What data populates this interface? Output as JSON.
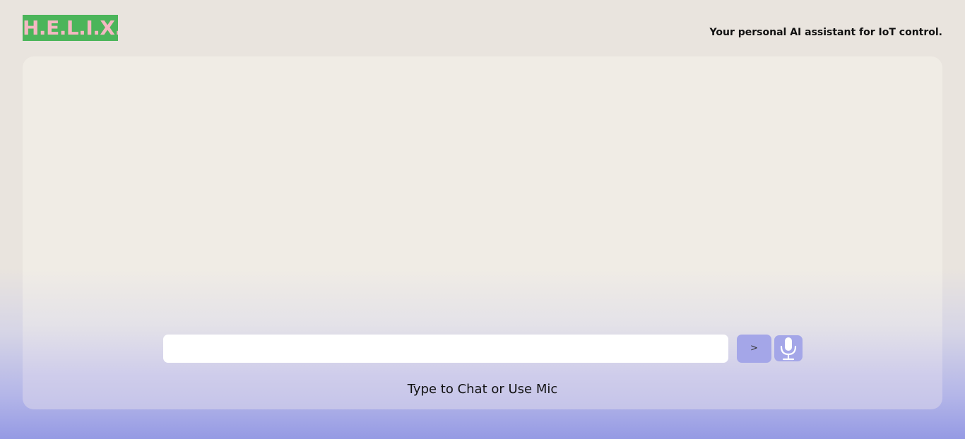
{
  "header": {
    "logo_text": "H.E.L.I.X.",
    "tagline": "Your personal AI assistant for IoT control."
  },
  "chat": {
    "input_value": "",
    "input_placeholder": "",
    "send_label": ">",
    "mic_icon": "microphone-icon",
    "hint": "Type to Chat or Use Mic"
  },
  "colors": {
    "logo_background": "#4bb55a",
    "logo_text": "#f4b8c2",
    "button_background": "#a4a6e8",
    "page_background_top": "#e9e4de",
    "page_background_bottom": "#959ae4"
  }
}
